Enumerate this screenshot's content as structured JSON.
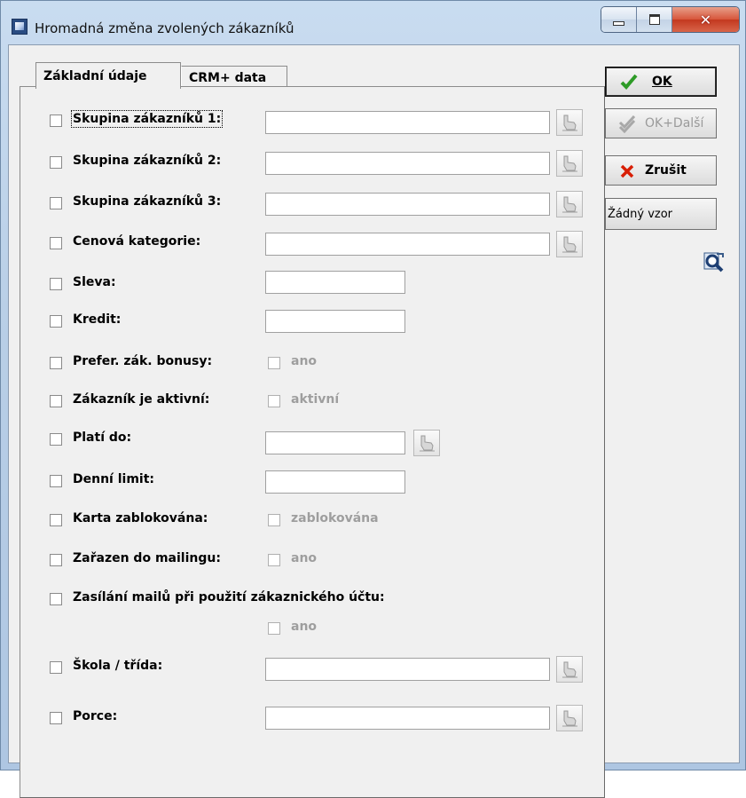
{
  "window": {
    "title": "Hromadná změna zvolených zákazníků"
  },
  "tabs": [
    {
      "label": "Základní údaje",
      "active": true
    },
    {
      "label": "CRM+ data",
      "active": false
    }
  ],
  "fields": [
    {
      "label": "Skupina zákazníků 1:",
      "type": "text-pick",
      "value": ""
    },
    {
      "label": "Skupina zákazníků 2:",
      "type": "text-pick",
      "value": ""
    },
    {
      "label": "Skupina zákazníků 3:",
      "type": "text-pick",
      "value": ""
    },
    {
      "label": "Cenová kategorie:",
      "type": "text-pick",
      "value": ""
    },
    {
      "label": "Sleva:",
      "type": "text",
      "value": ""
    },
    {
      "label": "Kredit:",
      "type": "text",
      "value": ""
    },
    {
      "label": "Prefer. zák. bonusy:",
      "type": "check",
      "option": "ano"
    },
    {
      "label": "Zákazník je aktivní:",
      "type": "check",
      "option": "aktivní"
    },
    {
      "label": "Platí do:",
      "type": "date-pick",
      "value": ""
    },
    {
      "label": "Denní limit:",
      "type": "text",
      "value": ""
    },
    {
      "label": "Karta zablokována:",
      "type": "check",
      "option": "zablokována"
    },
    {
      "label": "Zařazen do mailingu:",
      "type": "check",
      "option": "ano"
    },
    {
      "label": "Zasílání mailů při použití zákaznického účtu:",
      "type": "check-below",
      "option": "ano"
    },
    {
      "label": "Škola / třída:",
      "type": "text-pick",
      "value": ""
    },
    {
      "label": "Porce:",
      "type": "text-pick",
      "value": ""
    }
  ],
  "buttons": {
    "ok": "OK",
    "ok_dalsi": "OK+Další",
    "cancel": "Zrušit",
    "template": "Žádný vzor"
  },
  "colors": {
    "ok_check": "#2e9b27",
    "cancel_x": "#d81e05",
    "disabled_text": "#9e9e9e"
  },
  "icons": [
    "app-icon",
    "minimize-icon",
    "maximize-icon",
    "close-icon",
    "picker-hand-icon",
    "checkmark-icon",
    "x-icon",
    "template-search-icon"
  ]
}
